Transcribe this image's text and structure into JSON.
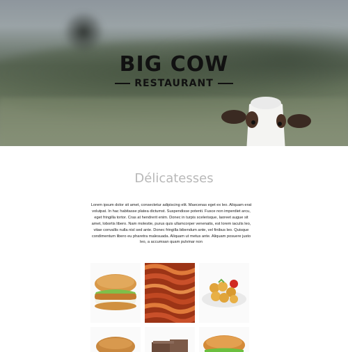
{
  "brand": {
    "title": "BIG COW",
    "subtitle": "RESTAURANT"
  },
  "section": {
    "title": "Délicatesses",
    "body": "Lorem ipsum dolor sit amet, consectetur adipiscing elit. Maecenas eget ex leo. Aliquam erat volutpat. In hac habitasse platea dictumst. Suspendisse potenti. Fusce non imperdiet arcu, eget fringilla tortor. Cras at hendrerit enim. Donec in turpis scelerisque, laoreet augue sit amet, lobortis libero. Nam molestie, purus quis ullamcorper venenatis, est lorem iaculis leo, vitae convallis nulla nisl sed ante. Donec fringilla bibendum ante, vel finibus leo. Quisque condimentum libero eu pharetra malesuada. Aliquam ut metus ante. Aliquam posuere justo leo, a accumsan quam pulvinar non"
  },
  "gallery": [
    {
      "name": "chicken-burger-photo"
    },
    {
      "name": "bacon-photo"
    },
    {
      "name": "nuggets-photo"
    },
    {
      "name": "burger-photo"
    },
    {
      "name": "brownie-photo"
    },
    {
      "name": "cheeseburger-photo"
    }
  ]
}
